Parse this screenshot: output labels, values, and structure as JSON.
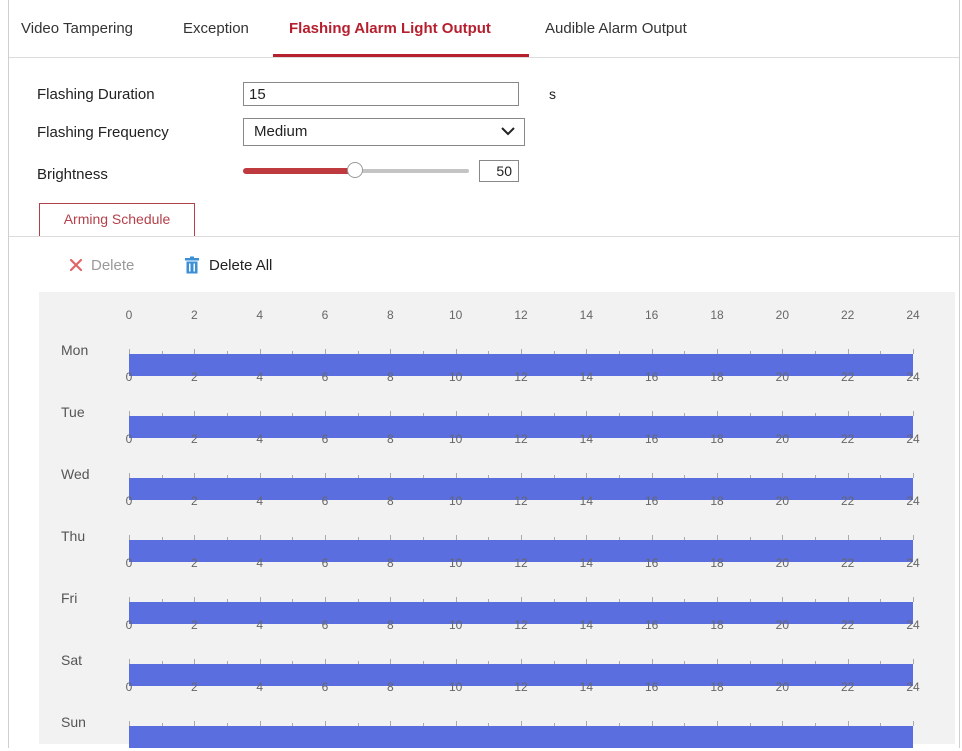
{
  "tabs": [
    {
      "label": "Video Tampering",
      "active": false
    },
    {
      "label": "Exception",
      "active": false
    },
    {
      "label": "Flashing Alarm Light Output",
      "active": true
    },
    {
      "label": "Audible Alarm Output",
      "active": false
    }
  ],
  "form": {
    "duration_label": "Flashing Duration",
    "duration_value": "15",
    "duration_unit": "s",
    "frequency_label": "Flashing Frequency",
    "frequency_value": "Medium",
    "brightness_label": "Brightness",
    "brightness_value": "50",
    "brightness_fraction": 0.5
  },
  "schedule": {
    "tab_label": "Arming Schedule",
    "delete_label": "Delete",
    "delete_all_label": "Delete All",
    "hours": [
      "0",
      "2",
      "4",
      "6",
      "8",
      "10",
      "12",
      "14",
      "16",
      "18",
      "20",
      "22",
      "24"
    ],
    "days": [
      {
        "label": "Mon",
        "start": 0,
        "end": 24
      },
      {
        "label": "Tue",
        "start": 0,
        "end": 24
      },
      {
        "label": "Wed",
        "start": 0,
        "end": 24
      },
      {
        "label": "Thu",
        "start": 0,
        "end": 24
      },
      {
        "label": "Fri",
        "start": 0,
        "end": 24
      },
      {
        "label": "Sat",
        "start": 0,
        "end": 24
      },
      {
        "label": "Sun",
        "start": 0,
        "end": 24
      }
    ]
  },
  "colors": {
    "accent": "#b51f2e",
    "schedule_bar": "#5a6ee0",
    "slider_fill": "#bf3a3e",
    "delete_icon": "#e06666",
    "trash_icon": "#3a8fd6"
  },
  "icons": {
    "delete": "close-icon",
    "delete_all": "trash-icon",
    "dropdown": "chevron-down-icon"
  }
}
